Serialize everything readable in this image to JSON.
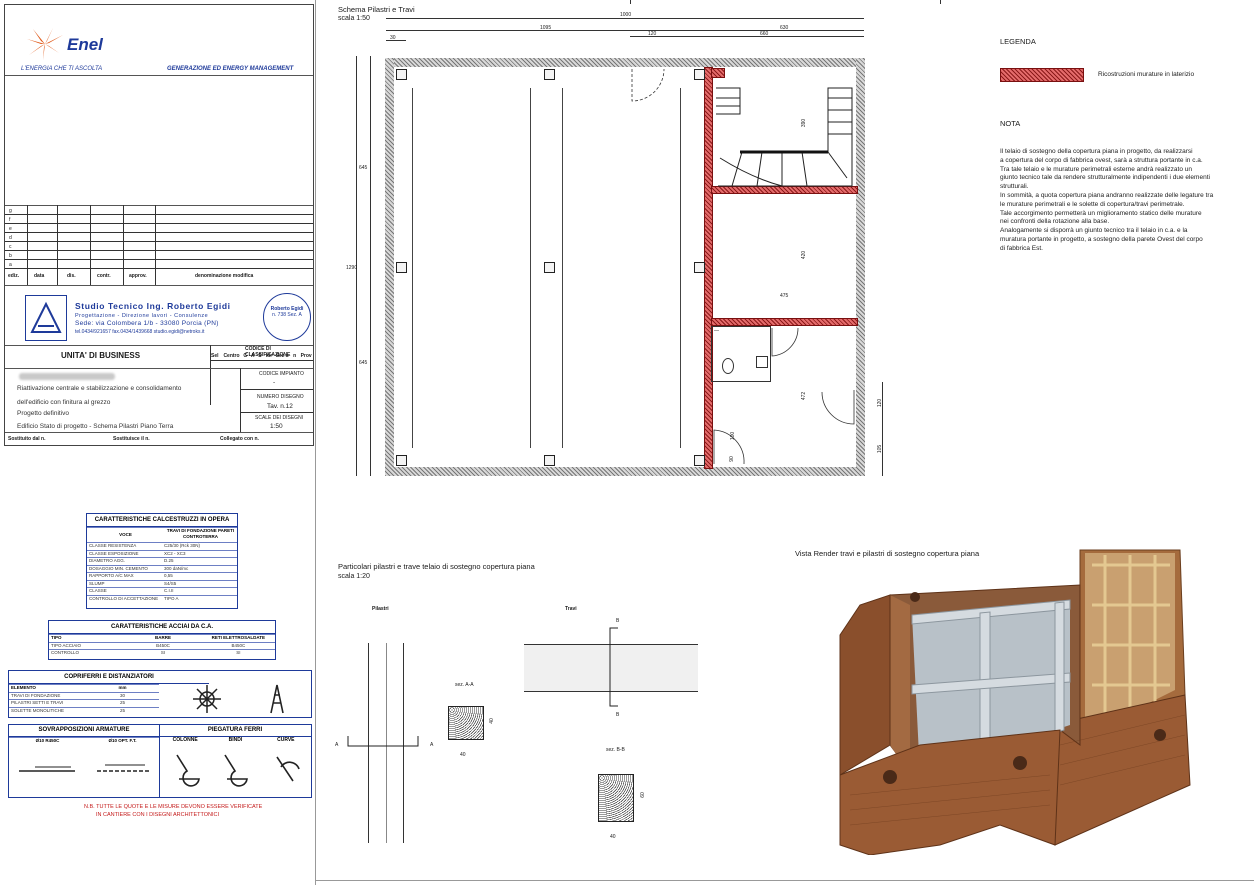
{
  "titleblock": {
    "brand": "Enel",
    "tagline": "L'ENERGIA CHE TI ASCOLTA",
    "division": "GENERAZIONE ED ENERGY MANAGEMENT",
    "revision_letters": [
      "g",
      "f",
      "e",
      "d",
      "c",
      "b",
      "a"
    ],
    "rev_headers": [
      "ediz.",
      "data",
      "dis.",
      "contr.",
      "approv.",
      "denominazione modifica"
    ],
    "studio_name": "Studio Tecnico Ing. Roberto Egidi",
    "studio_sub": "Progettazione - Direzione lavori - Consulenze",
    "studio_address": "Sede: via Colombera 1/b - 33080 Porcia (PN)",
    "studio_contacts": "tel.0434/921657 fax.0434/1439668 studio.egidi@netroks.it",
    "stamp_name": "Roberto Egidi",
    "stamp_num": "n. 738 Sez. A",
    "unit_label": "UNITA' DI BUSINESS",
    "classif_label": "CODICE DI CLASSIFICAZIONE",
    "classif_cols": [
      "Sel",
      "Centro",
      "G",
      "A",
      "S",
      "Idr",
      "Sez",
      "a",
      "n",
      "Prov"
    ],
    "description_1": "Riattivazione centrale e stabilizzazione e consolidamento",
    "description_2": "dell'edificio con finitura al grezzo",
    "description_3": "Progetto definitivo",
    "description_4": "Edificio Stato di progetto - Schema Pilastri Piano Terra",
    "code_label": "CODICE IMPIANTO",
    "code_value": "-",
    "drawing_label": "NUMERO DISEGNO",
    "drawing_value": "Tav. n.12",
    "scale_label": "SCALE DEI DISEGNI",
    "scale_value": "1:50",
    "footer_1": "Sostituito dal n.",
    "footer_2": "Sostituisce il n.",
    "footer_3": "Collegato con n."
  },
  "plan": {
    "title": "Schema Pilastri e Travi",
    "scale": "scala 1:50",
    "dims": [
      "1000",
      "1095",
      "630",
      "120",
      "660",
      "30",
      "645",
      "1290",
      "645",
      "390",
      "420",
      "475",
      "472",
      "100",
      "90",
      "120",
      "105"
    ]
  },
  "legend": {
    "title": "LEGENDA",
    "item": "Ricostruzioni murature in laterizio"
  },
  "note": {
    "title": "NOTA",
    "lines": [
      "Il telaio di sostegno della copertura piana in progetto, da realizzarsi",
      "a copertura del corpo di fabbrica ovest, sarà a struttura portante in c.a.",
      "Tra tale telaio e le murature perimetrali esterne andrà realizzato un",
      "giunto tecnico tale da rendere strutturalmente indipendenti i due elementi",
      "strutturali.",
      "In sommità, a quota copertura piana andranno realizzate delle legature tra",
      "le murature perimetrali e le solette di copertura/travi perimetrale.",
      "Tale accorgimento permetterà un miglioramento statico delle murature",
      "nei confronti della rotazione alla base.",
      "Analogamente si disporrà un giunto tecnico tra il telaio in c.a. e la",
      "muratura portante in progetto, a sostegno della parete Ovest del corpo",
      "di fabbrica Est."
    ]
  },
  "specs": {
    "cls_title": "CARATTERISTICHE CALCESTRUZZI IN OPERA",
    "cls_col1": "VOCE",
    "cls_col2": "TRAVI DI FONDAZIONE PARETI CONTROTERRA",
    "cls_rows": [
      [
        "CLASSE RESISTENZA",
        "C25/30 (Rck 30N)"
      ],
      [
        "CLASSE ESPOSIZIONE",
        "XC2 - XC3"
      ],
      [
        "DIAMETRO AGG.",
        "D.25"
      ],
      [
        "DOSAGGIO MIN. CEMENTO",
        "300 daN/mc"
      ],
      [
        "RAPPORTO A/C MAX",
        "0,55"
      ],
      [
        "SLUMP",
        "S4/S5"
      ],
      [
        "CLASSE",
        "C.I.II"
      ],
      [
        "CONTROLLO DI ACCETTAZIONE",
        "TIPO A"
      ]
    ],
    "steel_title": "CARATTERISTICHE ACCIAI DA C.A.",
    "steel_cols": [
      "TIPO",
      "BARRE",
      "RETI ELETTROSALDATE"
    ],
    "steel_rows": [
      [
        "TIPO ACCIAIO",
        "B450C",
        "B450C"
      ],
      [
        "CONTROLLO",
        "SI",
        "SI"
      ]
    ],
    "cover_title": "COPRIFERRI E DISTANZIATORI",
    "cover_cols": [
      "ELEMENTO",
      "mm"
    ],
    "cover_rows": [
      [
        "TRAVI DI FONDAZIONE",
        "30"
      ],
      [
        "PILASTRI SETTI E TRAVI",
        "25"
      ],
      [
        "SOLETTE MONOLITICHE",
        "25"
      ]
    ],
    "overlap_title": "SOVRAPPOSIZIONI ARMATURE",
    "overlap_cols": [
      "Ø10 R450C",
      "Ø10 OPT. F.T."
    ],
    "bend_title": "PIEGATURA FERRI",
    "bend_cols": [
      "COLONNE",
      "BINDI",
      "CURVE"
    ],
    "warning_1": "N.B. TUTTE LE QUOTE E LE MISURE DEVONO ESSERE VERIFICATE",
    "warning_2": "IN CANTIERE CON I DISEGNI ARCHITETTONICI"
  },
  "details": {
    "title": "Particolari pilastri e trave telaio di sostegno copertura piana",
    "scale": "scala 1:20",
    "pilastri": "Pilastri",
    "travi": "Travi",
    "sez_a": "sez. A-A",
    "sez_b": "sez. B-B",
    "dim_40": "40",
    "dim_40b": "40",
    "label_a": "A",
    "label_b": "B",
    "dim_60": "60"
  },
  "render": {
    "title": "Vista Render travi e pilastri di sostegno copertura piana"
  },
  "colors": {
    "brand_blue": "#1e3a9a",
    "enel_orange": "#e05a1a",
    "wall_red": "#c44040"
  }
}
